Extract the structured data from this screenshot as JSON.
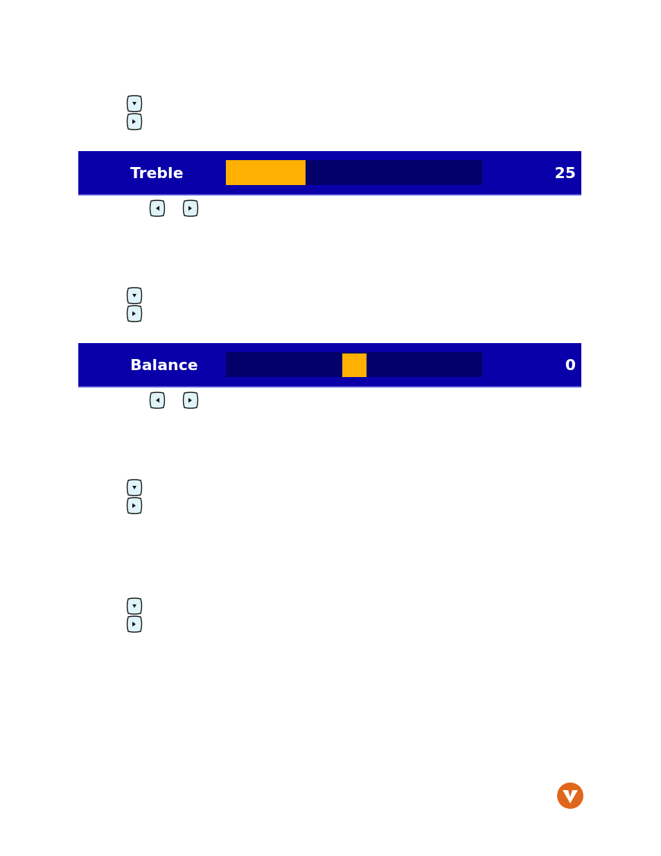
{
  "blocks": [
    {
      "kind": "keys",
      "keys": [
        {
          "kind": "down"
        },
        {
          "kind": "right"
        }
      ]
    },
    {
      "kind": "fill-slider",
      "label": "Treble",
      "level": 0.31,
      "reading": "25"
    },
    {
      "kind": "keys-row",
      "keys": [
        {
          "kind": "left"
        },
        {
          "kind": "right"
        }
      ]
    },
    {
      "kind": "keys",
      "keys": [
        {
          "kind": "down"
        },
        {
          "kind": "right"
        }
      ]
    },
    {
      "kind": "thumb-slider",
      "label": "Balance",
      "level": 0.5,
      "reading": "0"
    },
    {
      "kind": "keys-row",
      "keys": [
        {
          "kind": "left"
        },
        {
          "kind": "right"
        }
      ]
    },
    {
      "kind": "keys",
      "keys": [
        {
          "kind": "down"
        },
        {
          "kind": "right"
        }
      ]
    },
    {
      "kind": "keys",
      "keys": [
        {
          "kind": "down"
        },
        {
          "kind": "right"
        }
      ]
    }
  ]
}
